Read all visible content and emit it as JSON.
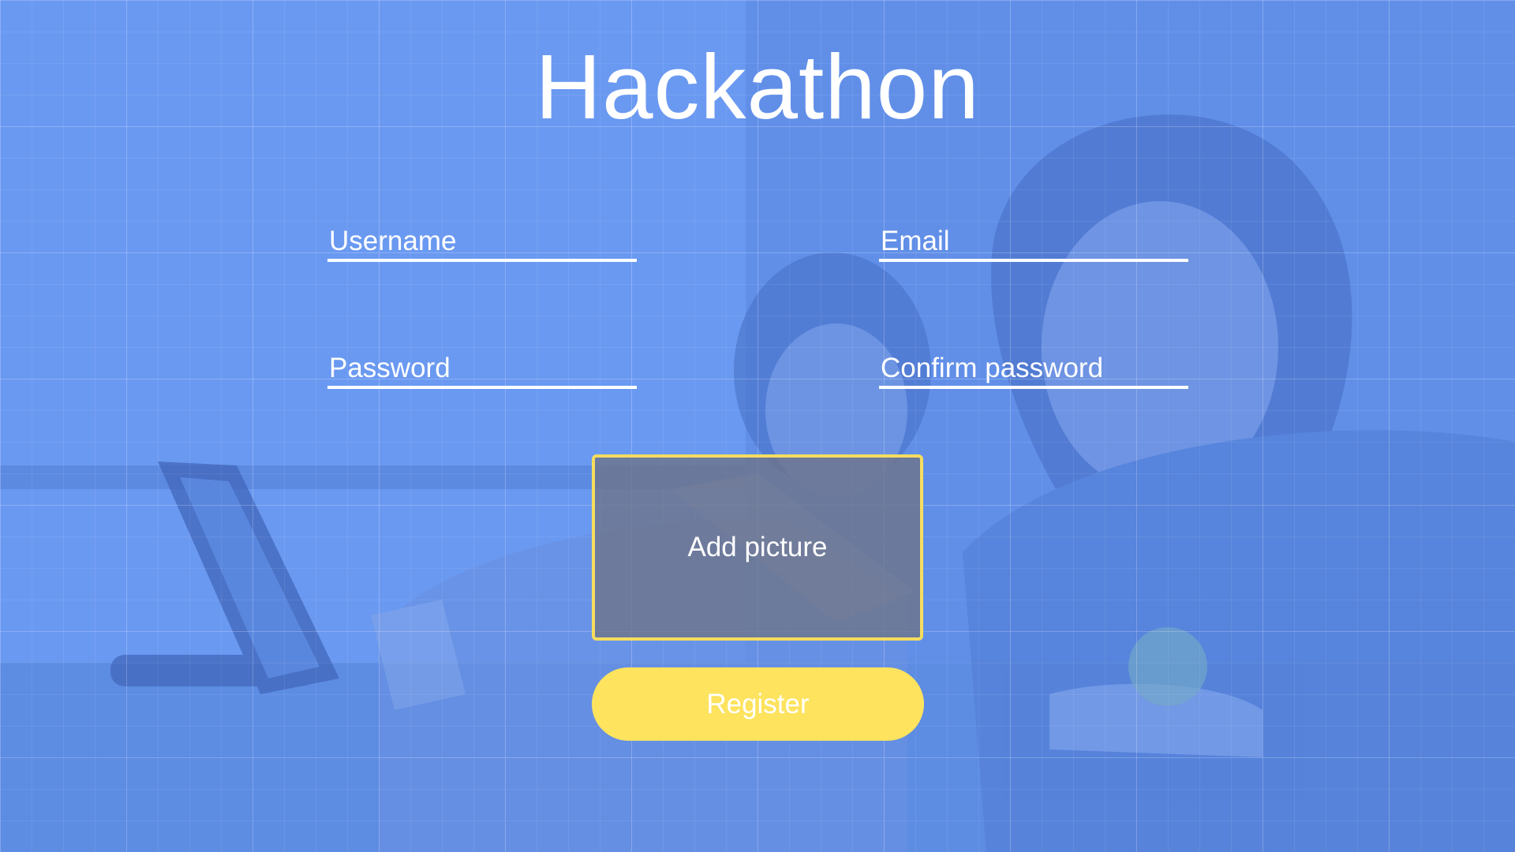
{
  "page": {
    "title": "Hackathon"
  },
  "form": {
    "username_placeholder": "Username",
    "email_placeholder": "Email",
    "password_placeholder": "Password",
    "confirm_password_placeholder": "Confirm password",
    "add_picture_label": "Add picture",
    "register_label": "Register"
  },
  "theme": {
    "background": "#6593ea",
    "accent": "#fde35e",
    "text": "#ffffff"
  }
}
